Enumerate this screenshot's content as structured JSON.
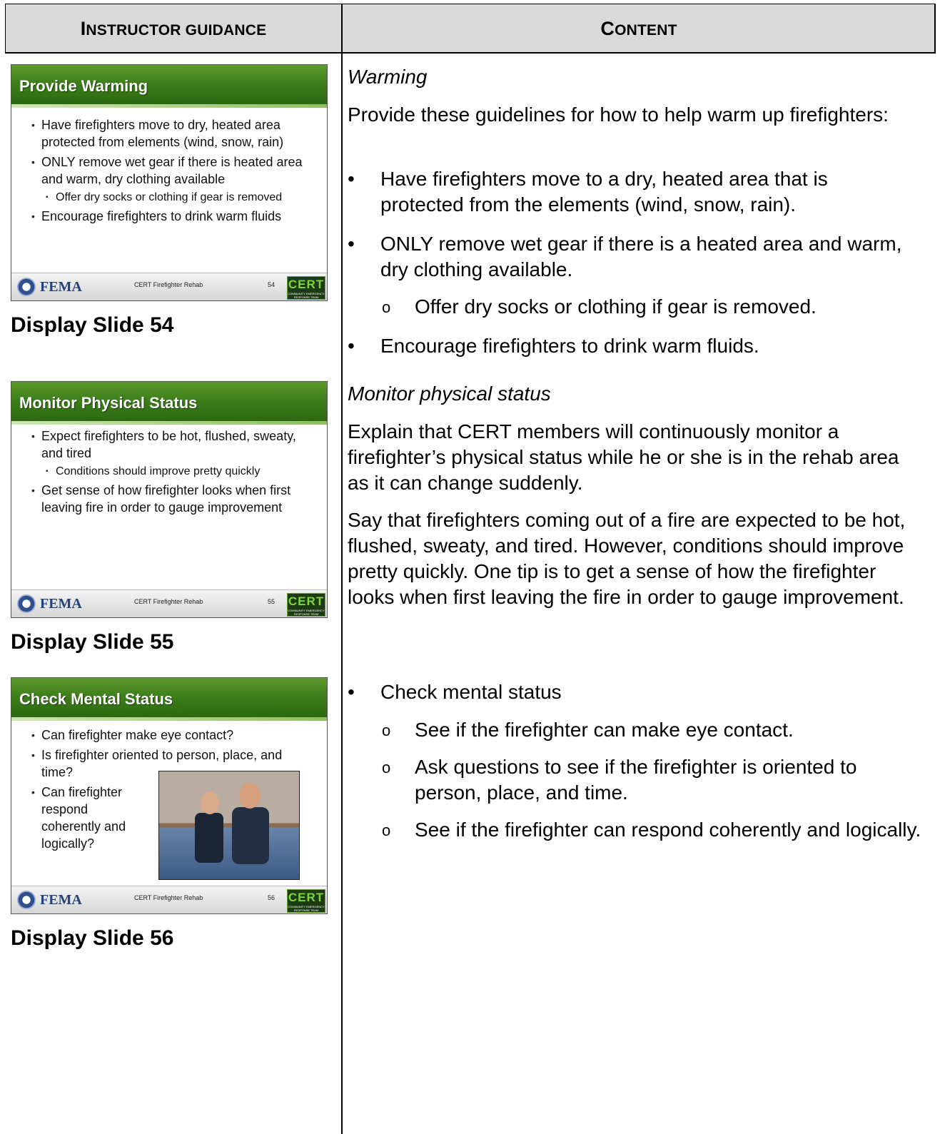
{
  "header": {
    "left_first": "I",
    "left_rest": "NSTRUCTOR GUIDANCE",
    "right_first": "C",
    "right_rest": "ONTENT"
  },
  "slides": [
    {
      "title": "Provide Warming",
      "bullets": [
        {
          "text": "Have firefighters move to dry, heated area protected from elements (wind, snow, rain)",
          "sub": false
        },
        {
          "text": "ONLY remove wet gear if there is heated area and warm, dry clothing available",
          "sub": false
        },
        {
          "text": "Offer dry socks or clothing if gear is removed",
          "sub": true
        },
        {
          "text": "Encourage firefighters to drink warm fluids",
          "sub": false
        }
      ],
      "footer_title": "CERT Firefighter Rehab",
      "number": "54",
      "display_label": "Display Slide 54"
    },
    {
      "title": "Monitor Physical Status",
      "bullets": [
        {
          "text": "Expect firefighters to be hot, flushed, sweaty, and tired",
          "sub": false
        },
        {
          "text": "Conditions should improve pretty quickly",
          "sub": true
        },
        {
          "text": "Get sense of how firefighter looks when first leaving fire in order to gauge improvement",
          "sub": false
        }
      ],
      "footer_title": "CERT Firefighter Rehab",
      "number": "55",
      "display_label": "Display Slide 55"
    },
    {
      "title": "Check Mental Status",
      "bullets": [
        {
          "text": "Can firefighter make eye contact?",
          "sub": false
        },
        {
          "text": "Is firefighter oriented to person, place, and time?",
          "sub": false
        },
        {
          "text": "Can firefighter respond coherently and logically?",
          "sub": false
        }
      ],
      "footer_title": "CERT Firefighter Rehab",
      "number": "56",
      "display_label": "Display Slide 56"
    }
  ],
  "footer_brand": "FEMA",
  "cert_logo": {
    "main": "CERT",
    "sub": "COMMUNITY EMERGENCY RESPONSE TEAM"
  },
  "content": {
    "warming_heading": "Warming",
    "warming_intro": "Provide these guidelines for how to help warm up firefighters:",
    "warming_bullets": [
      "Have firefighters move to a dry, heated area that is protected from the elements (wind, snow, rain).",
      "ONLY remove wet gear if there is a heated area and warm, dry clothing available.",
      "Offer dry socks or clothing if gear is removed.",
      "Encourage firefighters to drink warm fluids."
    ],
    "physical_heading": "Monitor physical status",
    "physical_para1": "Explain that CERT members will continuously monitor a firefighter’s physical status while he or she is in the rehab area as it can change suddenly.",
    "physical_para2": "Say that firefighters coming out of a fire are expected to be hot, flushed, sweaty, and tired. However, conditions should improve pretty quickly.  One tip is to get a sense of how the firefighter looks when first leaving the fire in order to gauge improvement.",
    "mental_bullet": "Check mental status",
    "mental_subs": [
      "See if the firefighter can make eye contact.",
      "Ask questions to see if the firefighter is oriented to person, place, and time.",
      "See if the firefighter can respond coherently and logically."
    ]
  }
}
